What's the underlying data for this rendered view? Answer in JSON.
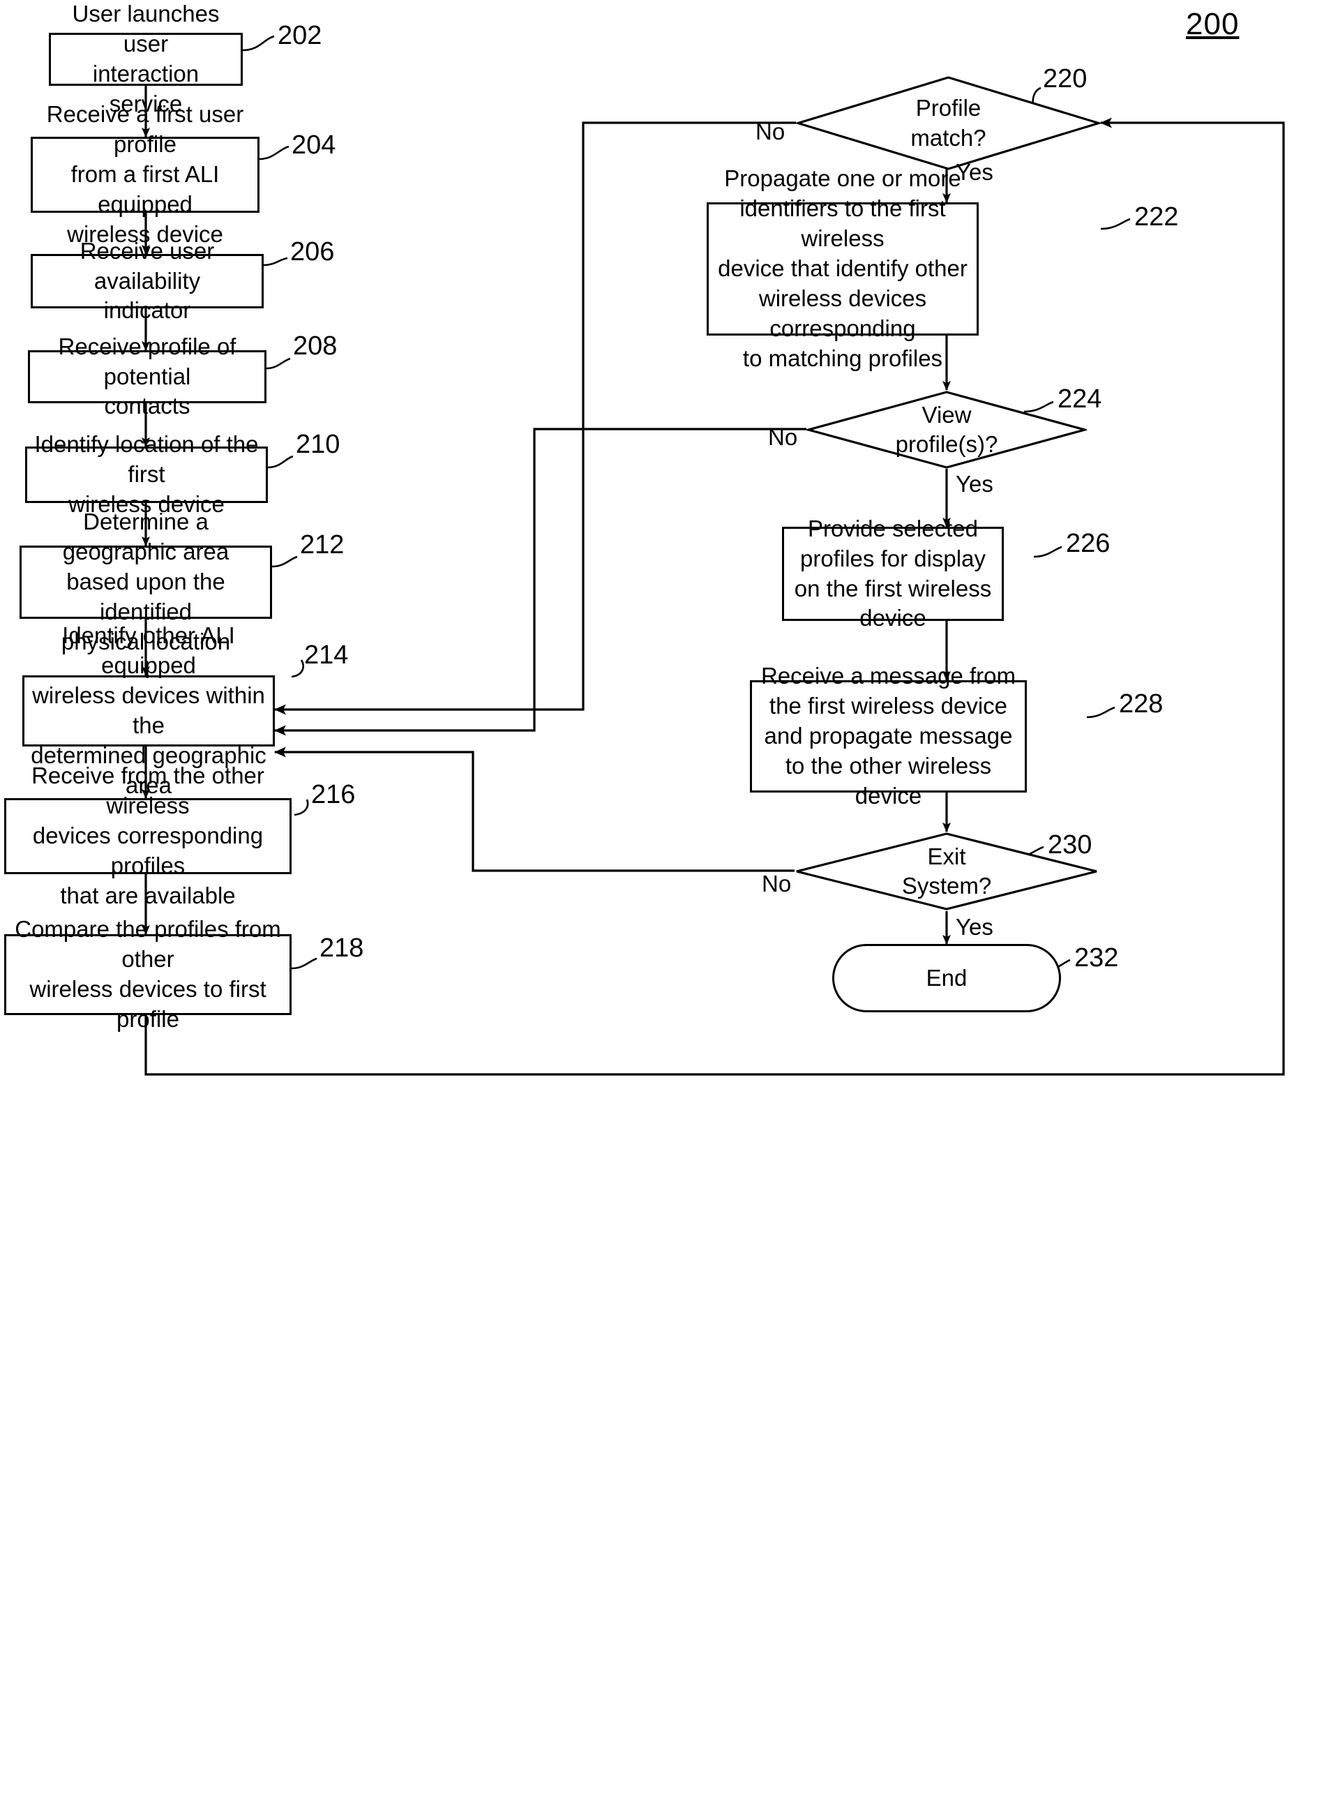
{
  "figure": {
    "number": "200",
    "type": "patent-flowchart"
  },
  "nodes": [
    {
      "id": "202",
      "shape": "process",
      "text": "User launches user\ninteraction service",
      "ref": "202"
    },
    {
      "id": "204",
      "shape": "process",
      "text": "Receive a first user profile\nfrom a first ALI equipped\nwireless device",
      "ref": "204"
    },
    {
      "id": "206",
      "shape": "process",
      "text": "Receive user availability\nindicator",
      "ref": "206"
    },
    {
      "id": "208",
      "shape": "process",
      "text": "Receive profile of potential\ncontacts",
      "ref": "208"
    },
    {
      "id": "210",
      "shape": "process",
      "text": "Identify location of the first\nwireless device",
      "ref": "210"
    },
    {
      "id": "212",
      "shape": "process",
      "text": "Determine a geographic area\nbased upon the identified\nphysical location",
      "ref": "212"
    },
    {
      "id": "214",
      "shape": "process",
      "text": "Identify other ALI equipped\nwireless devices within the\ndetermined geographic area",
      "ref": "214"
    },
    {
      "id": "216",
      "shape": "process",
      "text": "Receive from the other wireless\ndevices corresponding profiles\nthat are available",
      "ref": "216"
    },
    {
      "id": "218",
      "shape": "process",
      "text": "Compare the profiles from other\nwireless devices to first profile",
      "ref": "218"
    },
    {
      "id": "220",
      "shape": "decision",
      "text": "Profile\nmatch?",
      "ref": "220"
    },
    {
      "id": "222",
      "shape": "process",
      "text": "Propagate one or more\nidentifiers to the first wireless\ndevice that identify other\nwireless devices corresponding\nto matching profiles",
      "ref": "222"
    },
    {
      "id": "224",
      "shape": "decision",
      "text": "View\nprofile(s)?",
      "ref": "224"
    },
    {
      "id": "226",
      "shape": "process",
      "text": "Provide selected\nprofiles for display\non the first wireless\ndevice",
      "ref": "226"
    },
    {
      "id": "228",
      "shape": "process",
      "text": "Receive a message from\nthe first wireless device\nand propagate message\nto the other wireless\ndevice",
      "ref": "228"
    },
    {
      "id": "230",
      "shape": "decision",
      "text": "Exit\nSystem?",
      "ref": "230"
    },
    {
      "id": "232",
      "shape": "terminal",
      "text": "End",
      "ref": "232"
    }
  ],
  "edge_labels": {
    "profile_match_no": "No",
    "profile_match_yes": "Yes",
    "view_profiles_no": "No",
    "view_profiles_yes": "Yes",
    "exit_system_no": "No",
    "exit_system_yes": "Yes"
  },
  "refs": {
    "r202": "202",
    "r204": "204",
    "r206": "206",
    "r208": "208",
    "r210": "210",
    "r212": "212",
    "r214": "214",
    "r216": "216",
    "r218": "218",
    "r220": "220",
    "r222": "222",
    "r224": "224",
    "r226": "226",
    "r228": "228",
    "r230": "230",
    "r232": "232"
  },
  "colors": {
    "stroke": "#000000",
    "background": "#ffffff"
  }
}
